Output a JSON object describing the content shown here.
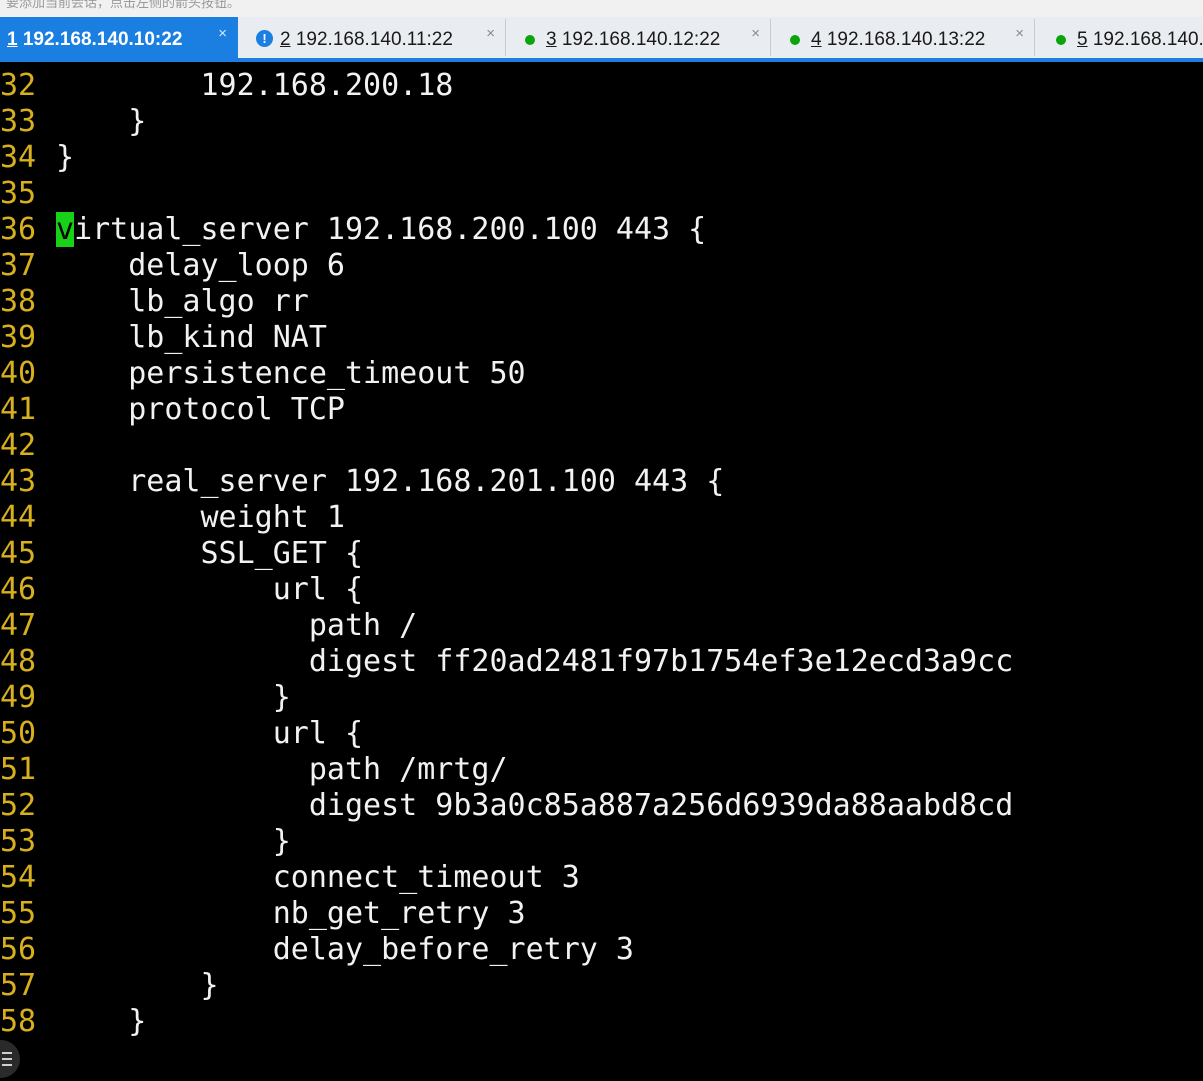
{
  "hint": {
    "text": "要添加当前会话，点击左侧的箭头按钮。"
  },
  "tabs": [
    {
      "num": "1",
      "host": " 192.168.140.10:22",
      "status": "active",
      "close": "×"
    },
    {
      "num": "2",
      "host": " 192.168.140.11:22",
      "status": "alert",
      "close": "×",
      "alert_glyph": "!"
    },
    {
      "num": "3",
      "host": " 192.168.140.12:22",
      "status": "connected",
      "close": "×"
    },
    {
      "num": "4",
      "host": " 192.168.140.13:22",
      "status": "connected",
      "close": "×"
    },
    {
      "num": "5",
      "host": " 192.168.140.",
      "status": "connected",
      "close": ""
    }
  ],
  "colors": {
    "accent": "#1a7fe0",
    "connected_dot": "#0aa50a",
    "line_number": "#d8b01c",
    "cursor": "#17d117"
  },
  "terminal": {
    "cursor_line": "36",
    "cursor_char": "v",
    "lines": [
      {
        "n": "32",
        "text": "        192.168.200.18"
      },
      {
        "n": "33",
        "text": "    }"
      },
      {
        "n": "34",
        "text": "}"
      },
      {
        "n": "35",
        "text": ""
      },
      {
        "n": "36",
        "text": "irtual_server 192.168.200.100 443 {"
      },
      {
        "n": "37",
        "text": "    delay_loop 6"
      },
      {
        "n": "38",
        "text": "    lb_algo rr"
      },
      {
        "n": "39",
        "text": "    lb_kind NAT"
      },
      {
        "n": "40",
        "text": "    persistence_timeout 50"
      },
      {
        "n": "41",
        "text": "    protocol TCP"
      },
      {
        "n": "42",
        "text": ""
      },
      {
        "n": "43",
        "text": "    real_server 192.168.201.100 443 {"
      },
      {
        "n": "44",
        "text": "        weight 1"
      },
      {
        "n": "45",
        "text": "        SSL_GET {"
      },
      {
        "n": "46",
        "text": "            url {"
      },
      {
        "n": "47",
        "text": "              path /"
      },
      {
        "n": "48",
        "text": "              digest ff20ad2481f97b1754ef3e12ecd3a9cc"
      },
      {
        "n": "49",
        "text": "            }"
      },
      {
        "n": "50",
        "text": "            url {"
      },
      {
        "n": "51",
        "text": "              path /mrtg/"
      },
      {
        "n": "52",
        "text": "              digest 9b3a0c85a887a256d6939da88aabd8cd"
      },
      {
        "n": "53",
        "text": "            }"
      },
      {
        "n": "54",
        "text": "            connect_timeout 3"
      },
      {
        "n": "55",
        "text": "            nb_get_retry 3"
      },
      {
        "n": "56",
        "text": "            delay_before_retry 3"
      },
      {
        "n": "57",
        "text": "        }"
      },
      {
        "n": "58",
        "text": "    }"
      }
    ]
  }
}
